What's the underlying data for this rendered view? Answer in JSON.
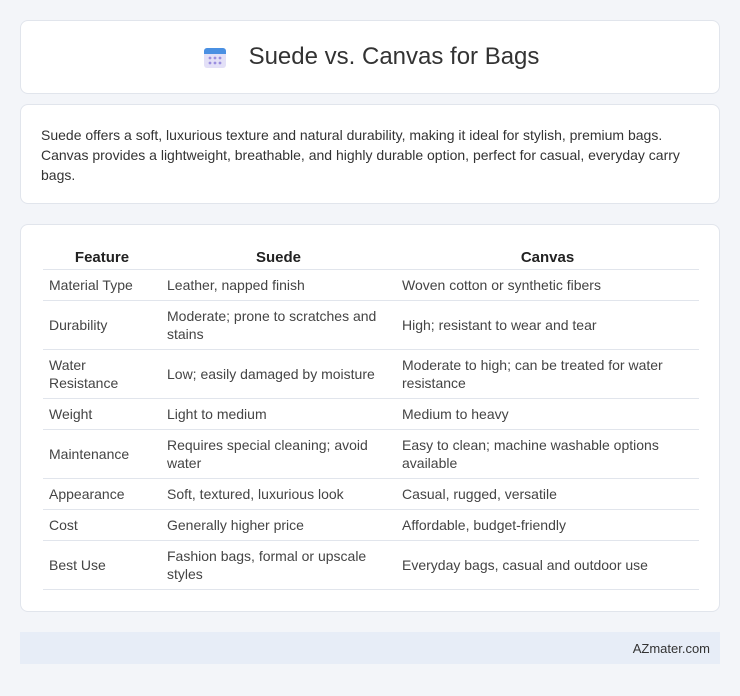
{
  "header": {
    "title": "Suede vs. Canvas for Bags",
    "icon": "calendar-icon"
  },
  "intro": {
    "text": "Suede offers a soft, luxurious texture and natural durability, making it ideal for stylish, premium bags. Canvas provides a lightweight, breathable, and highly durable option, perfect for casual, everyday carry bags."
  },
  "table": {
    "headers": [
      "Feature",
      "Suede",
      "Canvas"
    ],
    "rows": [
      [
        "Material Type",
        "Leather, napped finish",
        "Woven cotton or synthetic fibers"
      ],
      [
        "Durability",
        "Moderate; prone to scratches and stains",
        "High; resistant to wear and tear"
      ],
      [
        "Water Resistance",
        "Low; easily damaged by moisture",
        "Moderate to high; can be treated for water resistance"
      ],
      [
        "Weight",
        "Light to medium",
        "Medium to heavy"
      ],
      [
        "Maintenance",
        "Requires special cleaning; avoid water",
        "Easy to clean; machine washable options available"
      ],
      [
        "Appearance",
        "Soft, textured, luxurious look",
        "Casual, rugged, versatile"
      ],
      [
        "Cost",
        "Generally higher price",
        "Affordable, budget-friendly"
      ],
      [
        "Best Use",
        "Fashion bags, formal or upscale styles",
        "Everyday bags, casual and outdoor use"
      ]
    ]
  },
  "footer": {
    "text": "AZmater.com"
  }
}
